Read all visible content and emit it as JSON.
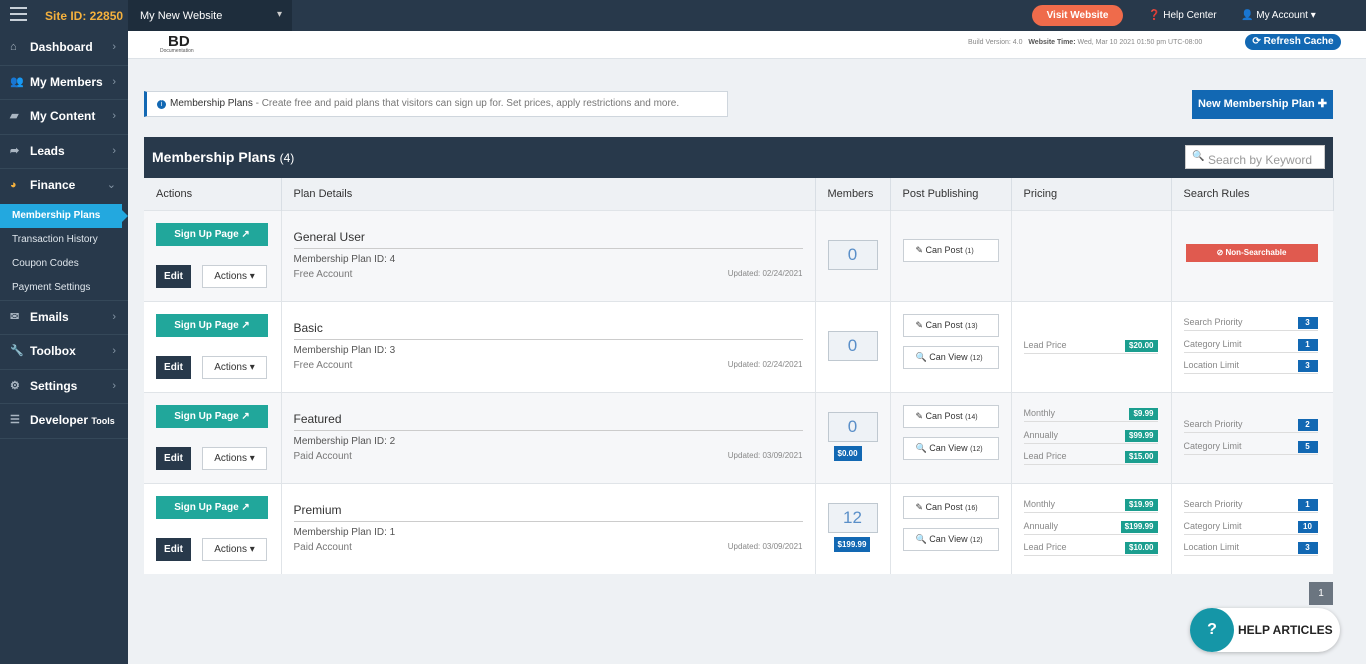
{
  "topbar": {
    "site_id": "Site ID: 22850",
    "site_name": "My New Website",
    "visit": "Visit Website",
    "help": "Help Center",
    "account": "My Account"
  },
  "sidebar": {
    "items": [
      "Dashboard",
      "My Members",
      "My Content",
      "Leads",
      "Finance",
      "Emails",
      "Toolbox",
      "Settings",
      "Developer"
    ],
    "developer_suffix": "Tools",
    "sub": [
      "Membership Plans",
      "Transaction History",
      "Coupon Codes",
      "Payment Settings"
    ]
  },
  "header": {
    "logo": "BD",
    "logo_sub": "Documentation",
    "build": "Build Version: 4.0",
    "website_time_label": "Website Time:",
    "website_time": "Wed, Mar 10 2021 01:50 pm UTC-08:00",
    "refresh": "Refresh Cache"
  },
  "info": {
    "title": "Membership Plans",
    "text": " - Create free and paid plans that visitors can sign up for. Set prices, apply restrictions and more."
  },
  "new_plan": "New Membership Plan",
  "card": {
    "title": "Membership Plans",
    "count": "(4)",
    "search_placeholder": "Search by Keyword",
    "columns": [
      "Actions",
      "Plan Details",
      "Members",
      "Post Publishing",
      "Pricing",
      "Search Rules"
    ]
  },
  "labels": {
    "signup": "Sign Up Page",
    "edit": "Edit",
    "actions": "Actions",
    "plan_id": "Membership Plan ID: ",
    "can_post": "Can Post",
    "can_view": "Can View",
    "non_searchable": "Non-Searchable"
  },
  "plans": [
    {
      "name": "General User",
      "id": "4",
      "type": "Free Account",
      "updated": "Updated: 02/24/2021",
      "members": "0",
      "post": "(1)",
      "pricing": [],
      "search": []
    },
    {
      "name": "Basic",
      "id": "3",
      "type": "Free Account",
      "updated": "Updated: 02/24/2021",
      "members": "0",
      "post": "(13)",
      "view": "(12)",
      "pricing": [
        {
          "label": "Lead Price",
          "value": "$20.00"
        }
      ],
      "search": [
        {
          "label": "Search Priority",
          "value": "3"
        },
        {
          "label": "Category Limit",
          "value": "1"
        },
        {
          "label": "Location Limit",
          "value": "3"
        }
      ]
    },
    {
      "name": "Featured",
      "id": "2",
      "type": "Paid Account",
      "updated": "Updated: 03/09/2021",
      "members": "0",
      "member_price": "$0.00",
      "post": "(14)",
      "view": "(12)",
      "pricing": [
        {
          "label": "Monthly",
          "value": "$9.99"
        },
        {
          "label": "Annually",
          "value": "$99.99"
        },
        {
          "label": "Lead Price",
          "value": "$15.00"
        }
      ],
      "search": [
        {
          "label": "Search Priority",
          "value": "2"
        },
        {
          "label": "Category Limit",
          "value": "5"
        }
      ]
    },
    {
      "name": "Premium",
      "id": "1",
      "type": "Paid Account",
      "updated": "Updated: 03/09/2021",
      "members": "12",
      "member_price": "$199.99",
      "post": "(16)",
      "view": "(12)",
      "pricing": [
        {
          "label": "Monthly",
          "value": "$19.99"
        },
        {
          "label": "Annually",
          "value": "$199.99"
        },
        {
          "label": "Lead Price",
          "value": "$10.00"
        }
      ],
      "search": [
        {
          "label": "Search Priority",
          "value": "1"
        },
        {
          "label": "Category Limit",
          "value": "10"
        },
        {
          "label": "Location Limit",
          "value": "3"
        }
      ]
    }
  ],
  "pagination": "1",
  "help_articles": "HELP ARTICLES"
}
